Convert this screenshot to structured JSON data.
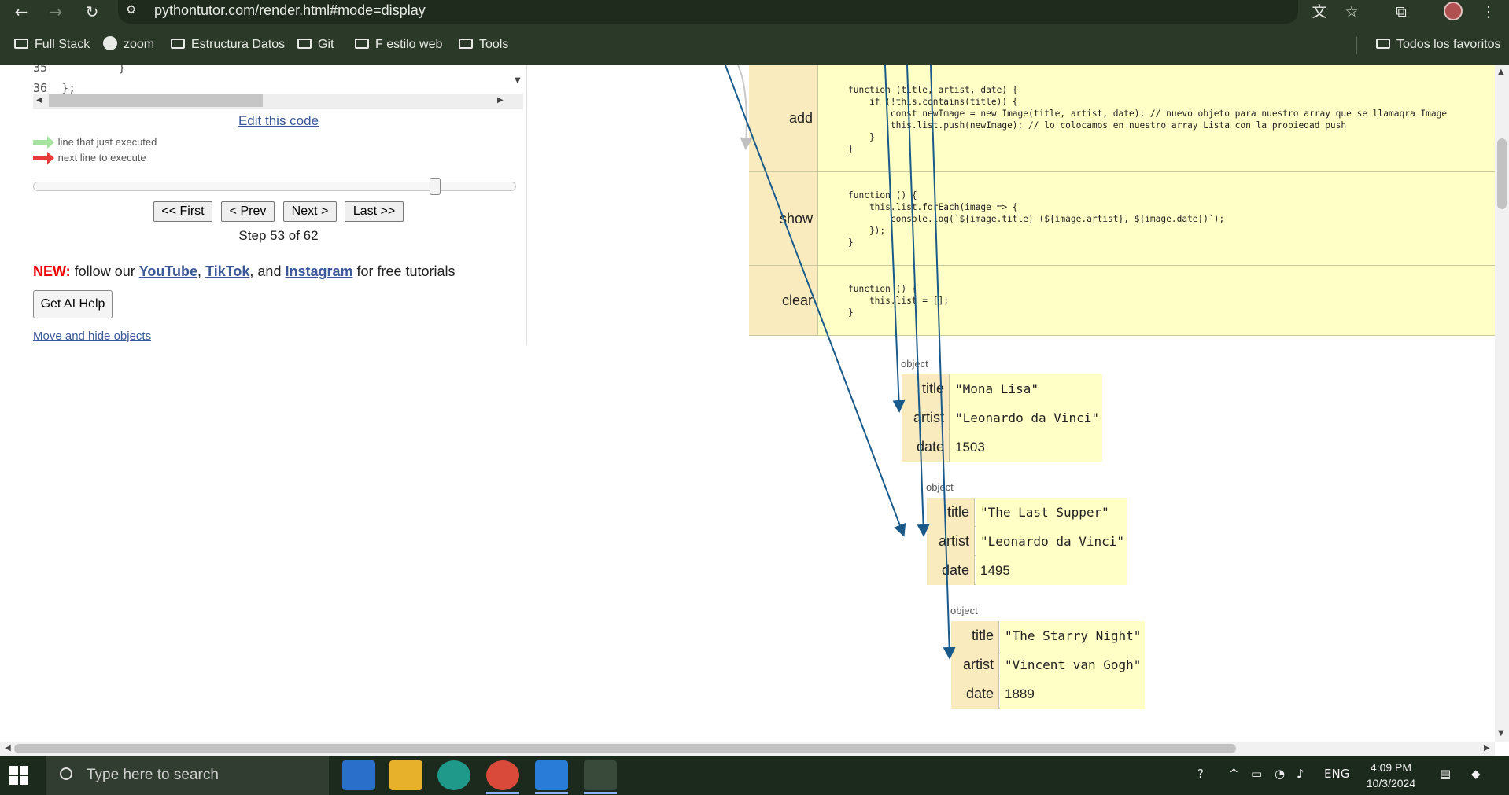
{
  "browser": {
    "url": "pythontutor.com/render.html#mode=display",
    "bookmarks": [
      {
        "label": "Full Stack",
        "icon": "folder-icon"
      },
      {
        "label": "zoom",
        "icon": "globe-icon"
      },
      {
        "label": "Estructura Datos",
        "icon": "folder-icon"
      },
      {
        "label": "Git",
        "icon": "folder-icon"
      },
      {
        "label": "F estilo web",
        "icon": "folder-icon"
      },
      {
        "label": "Tools",
        "icon": "folder-icon"
      }
    ],
    "all_bookmarks": "Todos los favoritos"
  },
  "left": {
    "code_lines": [
      {
        "num": "35",
        "text": "    }"
      },
      {
        "num": "36",
        "text": "};"
      }
    ],
    "edit_link": "Edit this code",
    "legend_executed": "line that just executed",
    "legend_next": "next line to execute",
    "colors": {
      "executed": "#a6e3a1",
      "next": "#e83a3a"
    },
    "slider_position": 0.85,
    "buttons": {
      "first": "<< First",
      "prev": "< Prev",
      "next": "Next >",
      "last": "Last >>"
    },
    "step_text": "Step 53 of 62",
    "promo": {
      "new": "NEW:",
      "lead": " follow our ",
      "youtube": "YouTube",
      "sep1": ", ",
      "tiktok": "TikTok",
      "sep2": ", and ",
      "instagram": "Instagram",
      "tail": " for free tutorials"
    },
    "ai_button": "Get AI Help",
    "move_link": "Move and hide objects"
  },
  "methods": [
    {
      "name": "add",
      "code": [
        "function (title, artist, date) {",
        "    if (!this.contains(title)) {",
        "        const newImage = new Image(title, artist, date); // nuevo objeto para nuestro array que se llamaqra Image",
        "        this.list.push(newImage); // lo colocamos en nuestro array Lista con la propiedad push",
        "    }",
        "}"
      ]
    },
    {
      "name": "show",
      "code": [
        "function () {",
        "    this.list.forEach(image => {",
        "        console.log(`${image.title} (${image.artist}, ${image.date})`);",
        "    });",
        "}"
      ]
    },
    {
      "name": "clear",
      "code": [
        "function () {",
        "    this.list = [];",
        "}"
      ]
    }
  ],
  "objects": [
    {
      "label": "object",
      "title": "\"Mona Lisa\"",
      "artist": "\"Leonardo da Vinci\"",
      "date": "1503"
    },
    {
      "label": "object",
      "title": "\"The Last Supper\"",
      "artist": "\"Leonardo da Vinci\"",
      "date": "1495"
    },
    {
      "label": "object",
      "title": "\"The Starry Night\"",
      "artist": "\"Vincent van Gogh\"",
      "date": "1889"
    }
  ],
  "object_keys": {
    "title": "title",
    "artist": "artist",
    "date": "date"
  },
  "taskbar": {
    "search_placeholder": "Type here to search",
    "language": "ENG",
    "time": "4:09 PM",
    "date": "10/3/2024"
  }
}
